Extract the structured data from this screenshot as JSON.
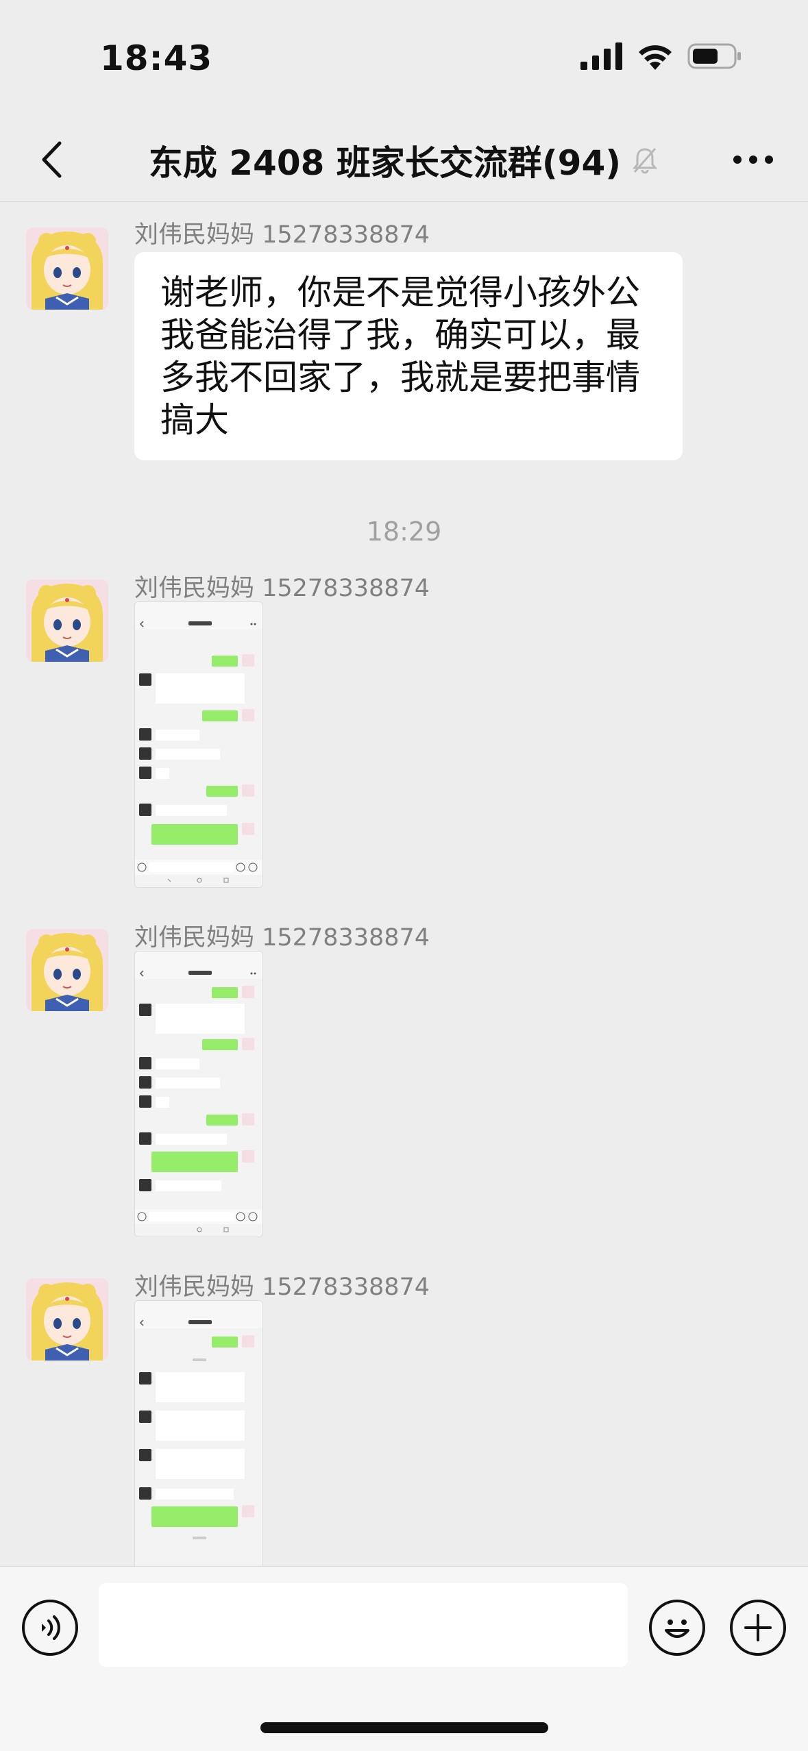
{
  "status_bar": {
    "time": "18:43"
  },
  "header": {
    "title": "东成 2408 班家长交流群(94)"
  },
  "messages": [
    {
      "sender": "刘伟民妈妈 15278338874",
      "text": "谢老师，你是不是觉得小孩外公我爸能治得了我，确实可以，最多我不回家了，我就是要把事情搞大"
    },
    {
      "sender": "刘伟民妈妈 15278338874"
    },
    {
      "sender": "刘伟民妈妈 15278338874"
    },
    {
      "sender": "刘伟民妈妈 15278338874"
    }
  ],
  "time_divider": "18:29",
  "input": {
    "value": ""
  },
  "colors": {
    "background": "#ededed",
    "bubble": "#ffffff",
    "sender_text": "#808080",
    "green_bubble": "#95ec69"
  }
}
